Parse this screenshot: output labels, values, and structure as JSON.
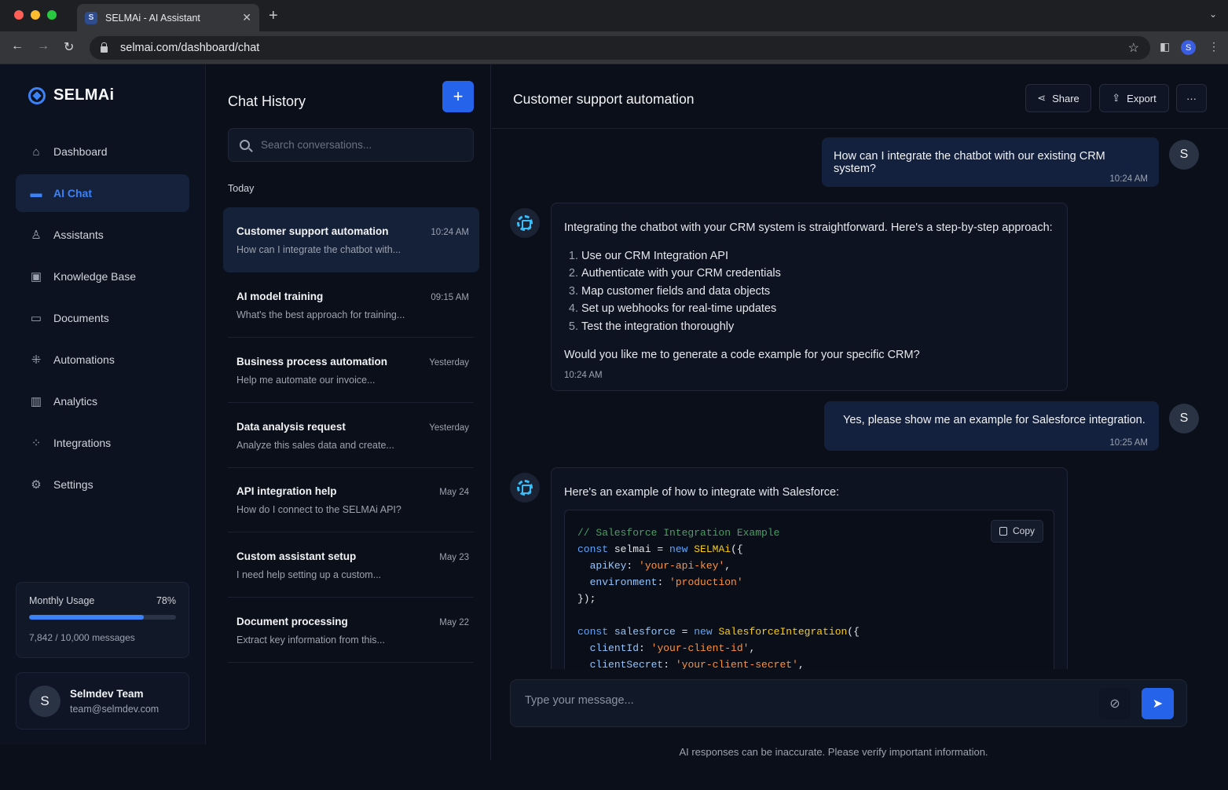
{
  "browser": {
    "tab_title": "SELMAi - AI Assistant",
    "tab_favicon": "S",
    "tab_close": "✕",
    "new_tab": "+",
    "url": "selmai.com/dashboard/chat",
    "profile_initial": "S"
  },
  "sidebar": {
    "brand": "SELMAi",
    "items": [
      {
        "label": "Dashboard",
        "icon": "home-icon",
        "glyph": "⌂",
        "active": false
      },
      {
        "label": "AI Chat",
        "icon": "chat-icon",
        "glyph": "▬",
        "active": true
      },
      {
        "label": "Assistants",
        "icon": "assistant-icon",
        "glyph": "♙",
        "active": false
      },
      {
        "label": "Knowledge Base",
        "icon": "knowledge-base-icon",
        "glyph": "▣",
        "active": false
      },
      {
        "label": "Documents",
        "icon": "document-icon",
        "glyph": "▭",
        "active": false
      },
      {
        "label": "Automations",
        "icon": "automation-icon",
        "glyph": "⁜",
        "active": false
      },
      {
        "label": "Analytics",
        "icon": "analytics-icon",
        "glyph": "▥",
        "active": false
      },
      {
        "label": "Integrations",
        "icon": "integrations-icon",
        "glyph": "⁘",
        "active": false
      },
      {
        "label": "Settings",
        "icon": "gear-icon",
        "glyph": "⚙",
        "active": false
      }
    ],
    "usage": {
      "label": "Monthly Usage",
      "percent_label": "78%",
      "percent": 0.78,
      "detail": "7,842 / 10,000 messages"
    },
    "user": {
      "initial": "S",
      "name": "Selmdev Team",
      "email": "team@selmdev.com"
    }
  },
  "history": {
    "title": "Chat History",
    "new_button": "+",
    "search_placeholder": "Search conversations...",
    "group_label": "Today",
    "conversations": [
      {
        "title": "Customer support automation",
        "time": "10:24 AM",
        "preview": "How can I integrate the chatbot with...",
        "active": true
      },
      {
        "title": "AI model training",
        "time": "09:15 AM",
        "preview": "What's the best approach for training...",
        "active": false
      },
      {
        "title": "Business process automation",
        "time": "Yesterday",
        "preview": "Help me automate our invoice...",
        "active": false
      },
      {
        "title": "Data analysis request",
        "time": "Yesterday",
        "preview": "Analyze this sales data and create...",
        "active": false
      },
      {
        "title": "API integration help",
        "time": "May 24",
        "preview": "How do I connect to the SELMAi API?",
        "active": false
      },
      {
        "title": "Custom assistant setup",
        "time": "May 23",
        "preview": "I need help setting up a custom...",
        "active": false
      },
      {
        "title": "Document processing",
        "time": "May 22",
        "preview": "Extract key information from this...",
        "active": false
      }
    ]
  },
  "chat": {
    "title": "Customer support automation",
    "share_label": "Share",
    "export_label": "Export",
    "more_label": "···",
    "user_initial": "S",
    "messages": {
      "m1": {
        "text": "How can I integrate the chatbot with our existing CRM system?",
        "time": "10:24 AM"
      },
      "m2": {
        "intro": "Integrating the chatbot with your CRM system is straightforward. Here's a step-by-step approach:",
        "steps": [
          "Use our CRM Integration API",
          "Authenticate with your CRM credentials",
          "Map customer fields and data objects",
          "Set up webhooks for real-time updates",
          "Test the integration thoroughly"
        ],
        "question": "Would you like me to generate a code example for your specific CRM?",
        "time": "10:24 AM"
      },
      "m3": {
        "text": "Yes, please show me an example for Salesforce integration.",
        "time": "10:25 AM"
      },
      "m4": {
        "intro": "Here's an example of how to integrate with Salesforce:",
        "copy_label": "Copy",
        "code": {
          "comment": "// Salesforce Integration Example",
          "l1_kw": "const",
          "l1_var": " selmai = ",
          "l1_new": "new",
          "l1_fn": "SELMAi",
          "l1_end": "({",
          "l2_key": "apiKey",
          "l2_val": "'your-api-key'",
          "l3_key": "environment",
          "l3_val": "'production'",
          "l4": "});",
          "l6_kw": "const",
          "l6_var": "salesforce",
          "l6_new": "new",
          "l6_fn": "SalesforceIntegration",
          "l6_end": "({",
          "l7_key": "clientId",
          "l7_val": "'your-client-id'",
          "l8_key": "clientSecret",
          "l8_val": "'your-client-secret'"
        }
      }
    },
    "composer_placeholder": "Type your message...",
    "disclaimer": "AI responses can be inaccurate. Please verify important information."
  }
}
